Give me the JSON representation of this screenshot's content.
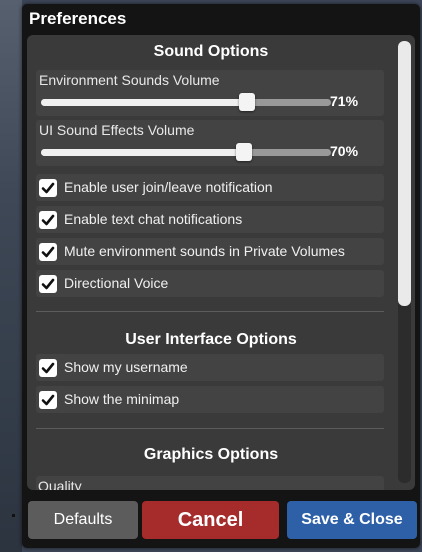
{
  "window": {
    "title": "Preferences"
  },
  "sound_options": {
    "title": "Sound Options",
    "environment_volume": {
      "label": "Environment Sounds Volume",
      "value_text": "71%",
      "value": 71
    },
    "ui_volume": {
      "label": "UI Sound Effects Volume",
      "value_text": "70%",
      "value": 70
    },
    "checkboxes": [
      {
        "label": "Enable user join/leave notification",
        "checked": true
      },
      {
        "label": "Enable text chat notifications",
        "checked": true
      },
      {
        "label": "Mute environment sounds in Private Volumes",
        "checked": true
      },
      {
        "label": "Directional Voice",
        "checked": true
      }
    ]
  },
  "ui_options": {
    "title": "User Interface Options",
    "checkboxes": [
      {
        "label": "Show my username",
        "checked": true
      },
      {
        "label": "Show the minimap",
        "checked": true
      }
    ]
  },
  "graphics_options": {
    "title": "Graphics Options",
    "quality_label": "Quality"
  },
  "buttons": {
    "defaults": "Defaults",
    "cancel": "Cancel",
    "save_close": "Save & Close"
  },
  "colors": {
    "cancel": "#a62b2b",
    "save": "#2e60a8",
    "panel": "#3a3a3a"
  },
  "scroll": {
    "position_fraction": 0.0,
    "visible_fraction": 0.6
  }
}
